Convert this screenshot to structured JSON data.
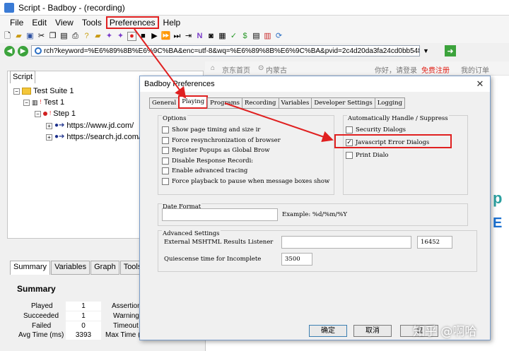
{
  "window": {
    "title": "Script - Badboy - (recording)"
  },
  "menu": [
    "File",
    "Edit",
    "View",
    "Tools",
    "Preferences",
    "Help"
  ],
  "address": {
    "url": "rch?keyword=%E6%89%8B%E6%9C%BA&enc=utf-8&wq=%E6%89%8B%E6%9C%BA&pvid=2c4d20da3fa24cd0bb54839bef2555de"
  },
  "left_tab": "Script",
  "tree": {
    "suite": "Test Suite 1",
    "test": "Test 1",
    "step": "Step 1",
    "req1": "https://www.jd.com/",
    "req2": "https://search.jd.com/"
  },
  "summary_tabs": [
    "Summary",
    "Variables",
    "Graph",
    "Tools"
  ],
  "summary": {
    "title": "Summary",
    "played_label": "Played",
    "played": "1",
    "succeeded_label": "Succeeded",
    "succeeded": "1",
    "failed_label": "Failed",
    "failed": "0",
    "avg_label": "Avg Time (ms)",
    "avg": "3393",
    "assertions_label": "Assertion",
    "warnings_label": "Warning",
    "timeouts_label": "Timeout",
    "maxtime_label": "Max Time ("
  },
  "browser": {
    "jd_home": "京东首页",
    "location": "内蒙古",
    "greeting": "你好，请登录",
    "register": "免费注册",
    "orders": "我的订单"
  },
  "dialog": {
    "title": "Badboy Preferences",
    "tabs": [
      "General",
      "Playing",
      "Programs",
      "Recording",
      "Variables",
      "Developer Settings",
      "Logging"
    ],
    "options_label": "Options",
    "options": [
      "Show page timing and size ir",
      "Force resynchronization of browser",
      "Register Popups as Global Brow",
      "Disable Response Recordi:",
      "Enable advanced tracing",
      "Force playback to pause when message boxes show"
    ],
    "auto_label": "Automatically Handle / Suppress",
    "auto": [
      {
        "label": "Security Dialogs",
        "checked": false
      },
      {
        "label": "Javascript Error Dialogs",
        "checked": true
      },
      {
        "label": "Print Dialo",
        "checked": false
      }
    ],
    "date_format_label": "Date Format",
    "date_example": "Example: %d/%m/%Y",
    "advanced_label": "Advanced Settings",
    "listener_label": "External MSHTML Results Listener",
    "listener_port": "16452",
    "quiescence_label": "Quiescense time for Incomplete",
    "quiescence_value": "3500",
    "ok": "确定",
    "cancel": "取消",
    "apply": "应"
  },
  "watermark": "知乎 @啊哈",
  "colors": {
    "annotation": "#e02020",
    "accent": "#3c7fb1"
  }
}
